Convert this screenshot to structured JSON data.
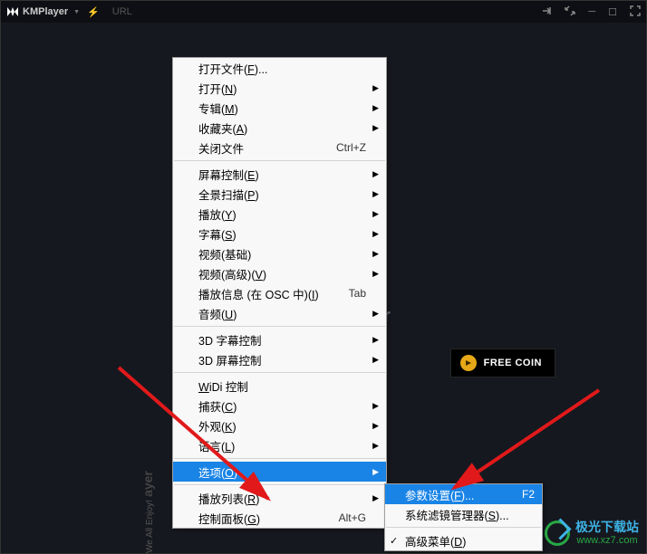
{
  "titlebar": {
    "app_name": "KMPlayer",
    "url_label": "URL"
  },
  "button": {
    "freecoin": "FREE COIN"
  },
  "center_overflow": "r",
  "side": {
    "slogan": "We All Enjoy!",
    "brand": "ayer"
  },
  "menu": [
    {
      "t": "item",
      "label": "打开文件(F)...",
      "accel": "F"
    },
    {
      "t": "item",
      "label": "打开(N)",
      "accel": "N",
      "arrow": true
    },
    {
      "t": "item",
      "label": "专辑(M)",
      "accel": "M",
      "arrow": true
    },
    {
      "t": "item",
      "label": "收藏夹(A)",
      "accel": "A",
      "arrow": true
    },
    {
      "t": "item",
      "label": "关闭文件",
      "shortcut": "Ctrl+Z"
    },
    {
      "t": "sep"
    },
    {
      "t": "item",
      "label": "屏幕控制(E)",
      "accel": "E",
      "arrow": true
    },
    {
      "t": "item",
      "label": "全景扫描(P)",
      "accel": "P",
      "arrow": true
    },
    {
      "t": "item",
      "label": "播放(Y)",
      "accel": "Y",
      "arrow": true
    },
    {
      "t": "item",
      "label": "字幕(S)",
      "accel": "S",
      "arrow": true
    },
    {
      "t": "item",
      "label": "视频(基础)",
      "arrow": true
    },
    {
      "t": "item",
      "label": "视频(高级)(V)",
      "accel": "V",
      "arrow": true
    },
    {
      "t": "item",
      "label": "播放信息 (在 OSC 中)(I)",
      "accel": "I",
      "shortcut": "Tab"
    },
    {
      "t": "item",
      "label": "音频(U)",
      "accel": "U",
      "arrow": true
    },
    {
      "t": "sep"
    },
    {
      "t": "item",
      "label": "3D 字幕控制",
      "arrow": true
    },
    {
      "t": "item",
      "label": "3D 屏幕控制",
      "arrow": true
    },
    {
      "t": "sep"
    },
    {
      "t": "item",
      "label": "WiDi 控制",
      "underline": "W"
    },
    {
      "t": "item",
      "label": "捕获(C)",
      "accel": "C",
      "arrow": true
    },
    {
      "t": "item",
      "label": "外观(K)",
      "accel": "K",
      "arrow": true
    },
    {
      "t": "item",
      "label": "语言(L)",
      "accel": "L",
      "arrow": true
    },
    {
      "t": "sep"
    },
    {
      "t": "item",
      "label": "选项(O)",
      "accel": "O",
      "arrow": true,
      "hover": true
    },
    {
      "t": "sep"
    },
    {
      "t": "item",
      "label": "播放列表(R)",
      "accel": "R",
      "arrow": true
    },
    {
      "t": "item",
      "label": "控制面板(G)",
      "accel": "G",
      "shortcut": "Alt+G"
    }
  ],
  "submenu": [
    {
      "t": "item",
      "label": "参数设置(F)...",
      "accel": "F",
      "shortcut": "F2",
      "hover": true
    },
    {
      "t": "item",
      "label": "系统滤镜管理器(S)...",
      "accel": "S"
    },
    {
      "t": "sep"
    },
    {
      "t": "item",
      "label": "高级菜单(D)",
      "accel": "D",
      "check": true
    }
  ],
  "watermark": {
    "cn": "极光下载站",
    "url": "www.xz7.com"
  }
}
